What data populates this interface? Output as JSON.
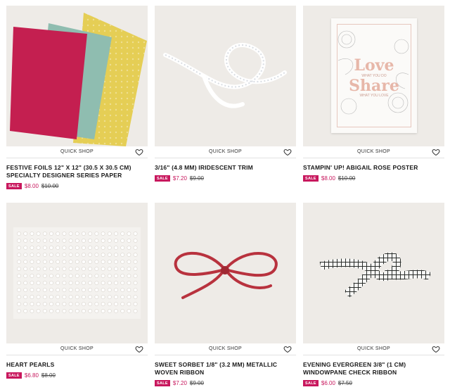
{
  "quick_shop_label": "QUICK SHOP",
  "sale_badge": "SALE",
  "products": [
    {
      "title_line1": "FESTIVE FOILS 12\" X 12\" (30.5 X 30.5 CM)",
      "title_line2": "SPECIALTY DESIGNER SERIES PAPER",
      "price": "$8.00",
      "old_price": "$10.00"
    },
    {
      "title_line1": "3/16\" (4.8 MM) IRIDESCENT TRIM",
      "title_line2": "",
      "price": "$7.20",
      "old_price": "$9.00"
    },
    {
      "title_line1": "STAMPIN' UP! ABIGAIL ROSE POSTER",
      "title_line2": "",
      "price": "$8.00",
      "old_price": "$10.00"
    },
    {
      "title_line1": "HEART PEARLS",
      "title_line2": "",
      "price": "$6.80",
      "old_price": "$8.00"
    },
    {
      "title_line1": "SWEET SORBET 1/8\" (3.2 MM) METALLIC",
      "title_line2": "WOVEN RIBBON",
      "price": "$7.20",
      "old_price": "$9.00"
    },
    {
      "title_line1": "EVENING EVERGREEN 3/8\" (1 CM)",
      "title_line2": "WINDOWPANE CHECK RIBBON",
      "price": "$6.00",
      "old_price": "$7.50"
    }
  ],
  "poster": {
    "word1": "Love",
    "sub1": "WHAT YOU DO",
    "word2": "Share",
    "sub2": "WHAT YOU LOVE"
  },
  "colors": {
    "sale": "#c8175d",
    "image_bg": "#eeebe7"
  },
  "icons": {
    "heart": "heart-outline-icon"
  }
}
